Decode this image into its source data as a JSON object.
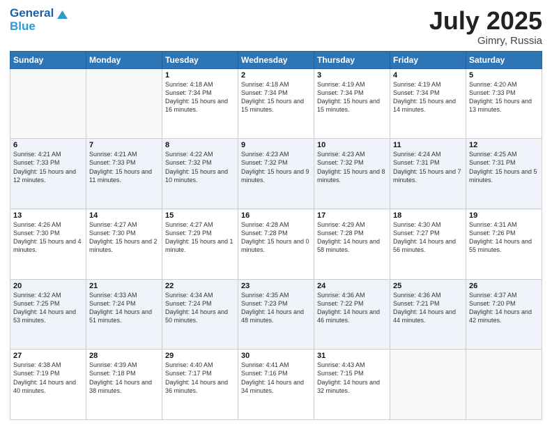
{
  "header": {
    "logo_line1": "General",
    "logo_line2": "Blue",
    "month": "July 2025",
    "location": "Gimry, Russia"
  },
  "days_of_week": [
    "Sunday",
    "Monday",
    "Tuesday",
    "Wednesday",
    "Thursday",
    "Friday",
    "Saturday"
  ],
  "weeks": [
    [
      {
        "num": "",
        "empty": true
      },
      {
        "num": "",
        "empty": true
      },
      {
        "num": "1",
        "sunrise": "4:18 AM",
        "sunset": "7:34 PM",
        "daylight": "15 hours and 16 minutes."
      },
      {
        "num": "2",
        "sunrise": "4:18 AM",
        "sunset": "7:34 PM",
        "daylight": "15 hours and 15 minutes."
      },
      {
        "num": "3",
        "sunrise": "4:19 AM",
        "sunset": "7:34 PM",
        "daylight": "15 hours and 15 minutes."
      },
      {
        "num": "4",
        "sunrise": "4:19 AM",
        "sunset": "7:34 PM",
        "daylight": "15 hours and 14 minutes."
      },
      {
        "num": "5",
        "sunrise": "4:20 AM",
        "sunset": "7:33 PM",
        "daylight": "15 hours and 13 minutes."
      }
    ],
    [
      {
        "num": "6",
        "sunrise": "4:21 AM",
        "sunset": "7:33 PM",
        "daylight": "15 hours and 12 minutes."
      },
      {
        "num": "7",
        "sunrise": "4:21 AM",
        "sunset": "7:33 PM",
        "daylight": "15 hours and 11 minutes."
      },
      {
        "num": "8",
        "sunrise": "4:22 AM",
        "sunset": "7:32 PM",
        "daylight": "15 hours and 10 minutes."
      },
      {
        "num": "9",
        "sunrise": "4:23 AM",
        "sunset": "7:32 PM",
        "daylight": "15 hours and 9 minutes."
      },
      {
        "num": "10",
        "sunrise": "4:23 AM",
        "sunset": "7:32 PM",
        "daylight": "15 hours and 8 minutes."
      },
      {
        "num": "11",
        "sunrise": "4:24 AM",
        "sunset": "7:31 PM",
        "daylight": "15 hours and 7 minutes."
      },
      {
        "num": "12",
        "sunrise": "4:25 AM",
        "sunset": "7:31 PM",
        "daylight": "15 hours and 5 minutes."
      }
    ],
    [
      {
        "num": "13",
        "sunrise": "4:26 AM",
        "sunset": "7:30 PM",
        "daylight": "15 hours and 4 minutes."
      },
      {
        "num": "14",
        "sunrise": "4:27 AM",
        "sunset": "7:30 PM",
        "daylight": "15 hours and 2 minutes."
      },
      {
        "num": "15",
        "sunrise": "4:27 AM",
        "sunset": "7:29 PM",
        "daylight": "15 hours and 1 minute."
      },
      {
        "num": "16",
        "sunrise": "4:28 AM",
        "sunset": "7:28 PM",
        "daylight": "15 hours and 0 minutes."
      },
      {
        "num": "17",
        "sunrise": "4:29 AM",
        "sunset": "7:28 PM",
        "daylight": "14 hours and 58 minutes."
      },
      {
        "num": "18",
        "sunrise": "4:30 AM",
        "sunset": "7:27 PM",
        "daylight": "14 hours and 56 minutes."
      },
      {
        "num": "19",
        "sunrise": "4:31 AM",
        "sunset": "7:26 PM",
        "daylight": "14 hours and 55 minutes."
      }
    ],
    [
      {
        "num": "20",
        "sunrise": "4:32 AM",
        "sunset": "7:25 PM",
        "daylight": "14 hours and 53 minutes."
      },
      {
        "num": "21",
        "sunrise": "4:33 AM",
        "sunset": "7:24 PM",
        "daylight": "14 hours and 51 minutes."
      },
      {
        "num": "22",
        "sunrise": "4:34 AM",
        "sunset": "7:24 PM",
        "daylight": "14 hours and 50 minutes."
      },
      {
        "num": "23",
        "sunrise": "4:35 AM",
        "sunset": "7:23 PM",
        "daylight": "14 hours and 48 minutes."
      },
      {
        "num": "24",
        "sunrise": "4:36 AM",
        "sunset": "7:22 PM",
        "daylight": "14 hours and 46 minutes."
      },
      {
        "num": "25",
        "sunrise": "4:36 AM",
        "sunset": "7:21 PM",
        "daylight": "14 hours and 44 minutes."
      },
      {
        "num": "26",
        "sunrise": "4:37 AM",
        "sunset": "7:20 PM",
        "daylight": "14 hours and 42 minutes."
      }
    ],
    [
      {
        "num": "27",
        "sunrise": "4:38 AM",
        "sunset": "7:19 PM",
        "daylight": "14 hours and 40 minutes."
      },
      {
        "num": "28",
        "sunrise": "4:39 AM",
        "sunset": "7:18 PM",
        "daylight": "14 hours and 38 minutes."
      },
      {
        "num": "29",
        "sunrise": "4:40 AM",
        "sunset": "7:17 PM",
        "daylight": "14 hours and 36 minutes."
      },
      {
        "num": "30",
        "sunrise": "4:41 AM",
        "sunset": "7:16 PM",
        "daylight": "14 hours and 34 minutes."
      },
      {
        "num": "31",
        "sunrise": "4:43 AM",
        "sunset": "7:15 PM",
        "daylight": "14 hours and 32 minutes."
      },
      {
        "num": "",
        "empty": true
      },
      {
        "num": "",
        "empty": true
      }
    ]
  ]
}
